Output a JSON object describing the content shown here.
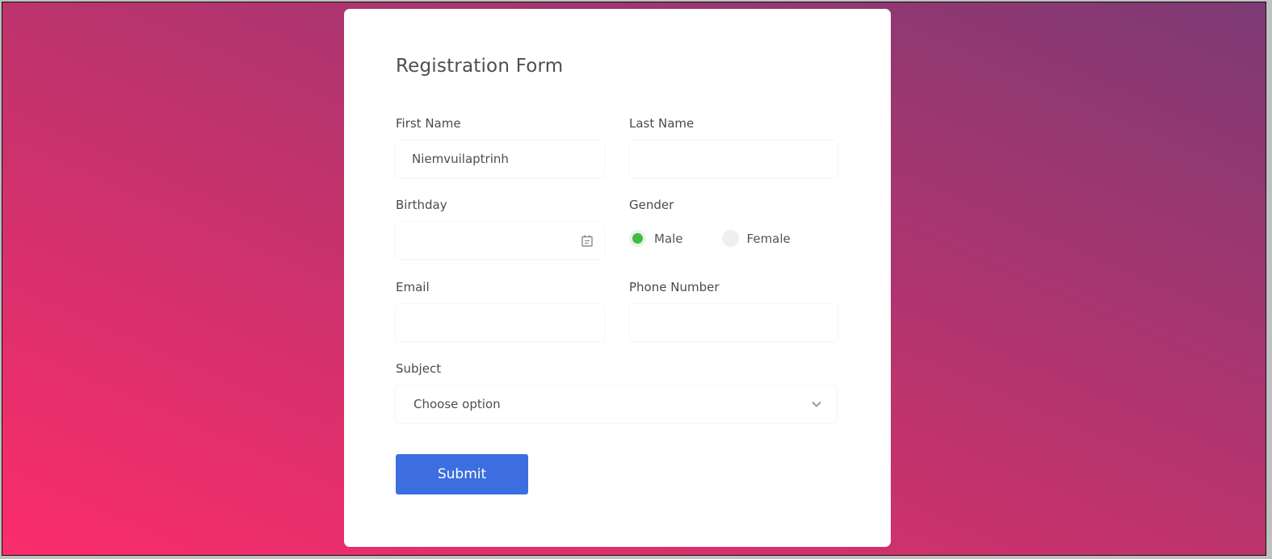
{
  "form": {
    "title": "Registration Form",
    "first_name": {
      "label": "First Name",
      "value": "Niemvuilaptrinh"
    },
    "last_name": {
      "label": "Last Name",
      "value": ""
    },
    "birthday": {
      "label": "Birthday",
      "value": "",
      "icon": "calendar-icon"
    },
    "gender": {
      "label": "Gender",
      "options": [
        {
          "label": "Male",
          "selected": true
        },
        {
          "label": "Female",
          "selected": false
        }
      ]
    },
    "email": {
      "label": "Email",
      "value": ""
    },
    "phone": {
      "label": "Phone Number",
      "value": ""
    },
    "subject": {
      "label": "Subject",
      "selected": "Choose option",
      "icon": "chevron-down-icon"
    },
    "submit_label": "Submit"
  },
  "colors": {
    "accent": "#3d6ee0",
    "radio_selected": "#3fbd3f",
    "gradient_start": "#fb2c6c",
    "gradient_end": "#7d3a74"
  }
}
